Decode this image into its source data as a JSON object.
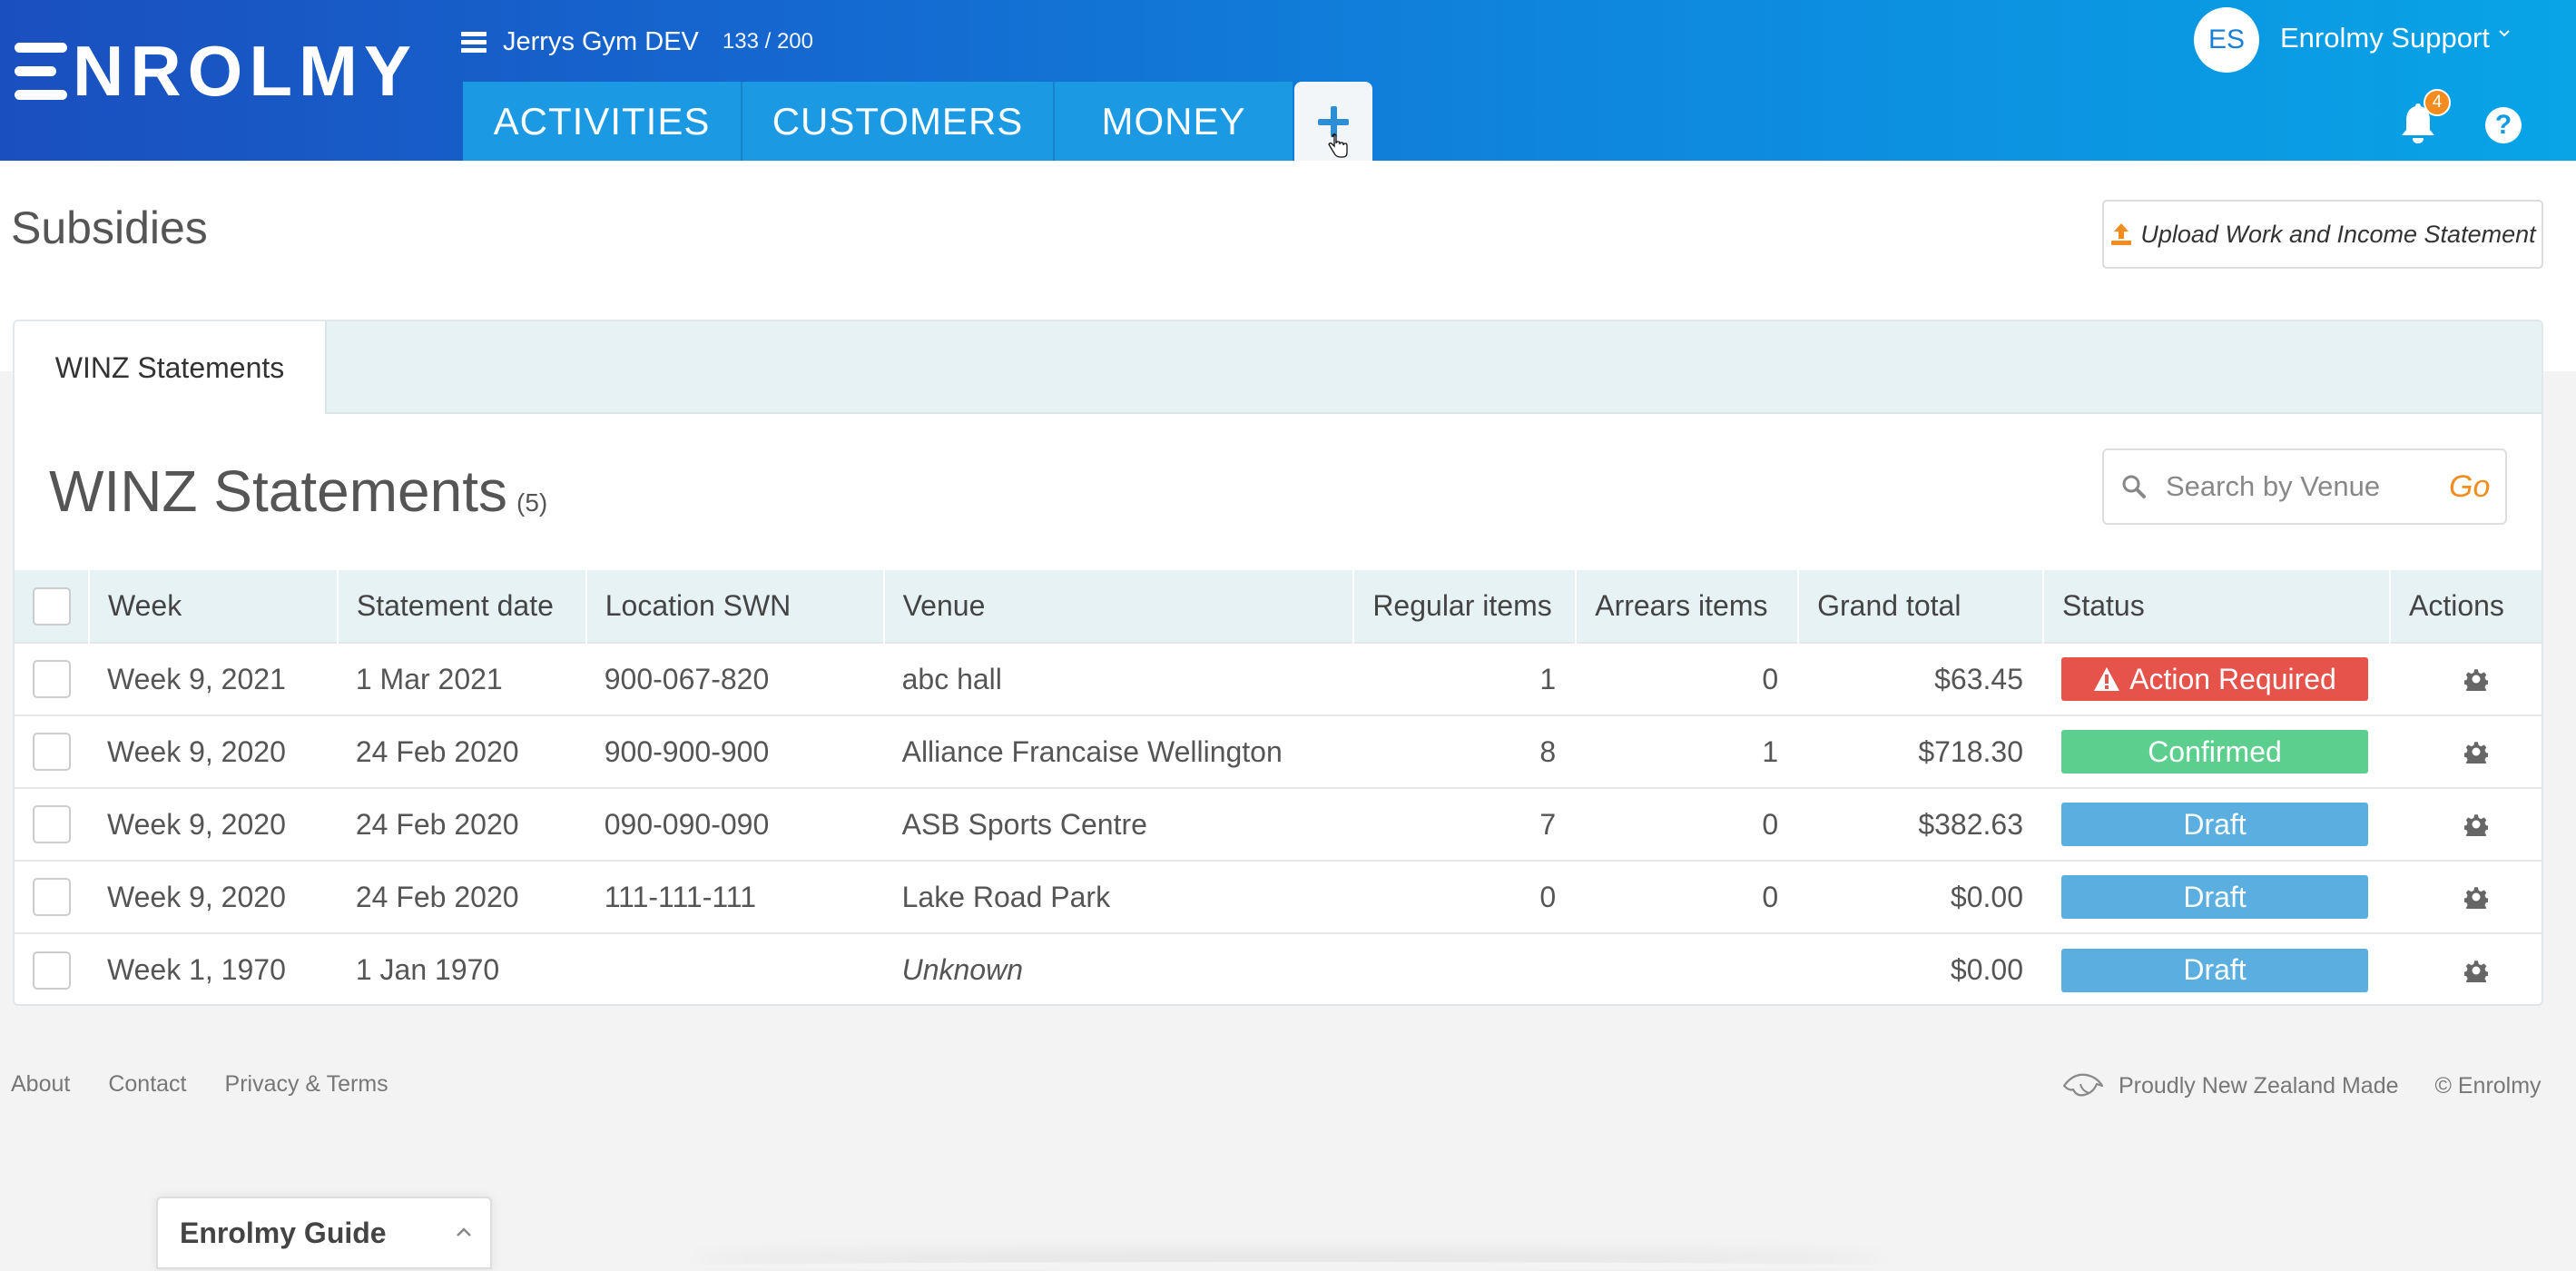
{
  "header": {
    "logo_text": "NROLMY",
    "org_name": "Jerrys Gym DEV",
    "org_count": "133 / 200",
    "tabs": [
      "ACTIVITIES",
      "CUSTOMERS",
      "MONEY"
    ],
    "add_tab_icon": "plus-icon",
    "user_initials": "ES",
    "user_name": "Enrolmy Support",
    "notification_count": "4",
    "help_label": "?",
    "brand_gradient": [
      "#1a4fbf",
      "#08a4e6"
    ]
  },
  "page": {
    "title": "Subsidies",
    "upload_button": "Upload Work and Income Statement"
  },
  "panel": {
    "tab_label": "WINZ Statements",
    "section_title": "WINZ Statements",
    "section_count": "(5)",
    "search_placeholder": "Search by Venue",
    "search_go": "Go",
    "columns": [
      "Week",
      "Statement date",
      "Location SWN",
      "Venue",
      "Regular items",
      "Arrears items",
      "Grand total",
      "Status",
      "Actions"
    ],
    "rows": [
      {
        "week": "Week 9, 2021",
        "date": "1 Mar 2021",
        "swn": "900-067-820",
        "venue": "abc hall",
        "regular": "1",
        "arrears": "0",
        "total": "$63.45",
        "status": "Action Required",
        "status_color": "#e5534b"
      },
      {
        "week": "Week 9, 2020",
        "date": "24 Feb 2020",
        "swn": "900-900-900",
        "venue": "Alliance Francaise Wellington",
        "regular": "8",
        "arrears": "1",
        "total": "$718.30",
        "status": "Confirmed",
        "status_color": "#5ccf8e"
      },
      {
        "week": "Week 9, 2020",
        "date": "24 Feb 2020",
        "swn": "090-090-090",
        "venue": "ASB Sports Centre",
        "regular": "7",
        "arrears": "0",
        "total": "$382.63",
        "status": "Draft",
        "status_color": "#5aafe0"
      },
      {
        "week": "Week 9, 2020",
        "date": "24 Feb 2020",
        "swn": "111-111-111",
        "venue": "Lake Road Park",
        "regular": "0",
        "arrears": "0",
        "total": "$0.00",
        "status": "Draft",
        "status_color": "#5aafe0"
      },
      {
        "week": "Week 1, 1970",
        "date": "1 Jan 1970",
        "swn": "",
        "venue": "Unknown",
        "regular": "",
        "arrears": "",
        "total": "$0.00",
        "status": "Draft",
        "status_color": "#5aafe0"
      }
    ]
  },
  "footer": {
    "links": [
      "About",
      "Contact",
      "Privacy & Terms"
    ],
    "made_in": "Proudly New Zealand Made",
    "copyright": "© Enrolmy"
  },
  "guide": {
    "label": "Enrolmy Guide"
  }
}
